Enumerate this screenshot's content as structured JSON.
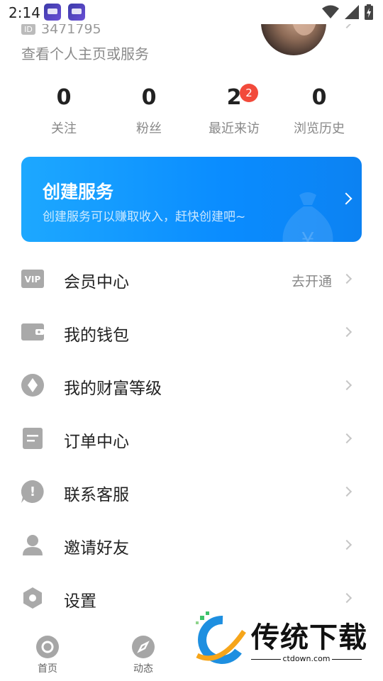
{
  "status_bar": {
    "time": "2:14"
  },
  "profile": {
    "id_tag": "ID",
    "id_number": "3471795",
    "link_text": "查看个人主页或服务"
  },
  "stats": [
    {
      "value": "0",
      "label": "关注"
    },
    {
      "value": "0",
      "label": "粉丝"
    },
    {
      "value": "2",
      "label": "最近来访",
      "badge": "2"
    },
    {
      "value": "0",
      "label": "浏览历史"
    }
  ],
  "banner": {
    "title": "创建服务",
    "subtitle": "创建服务可以赚取收入，赶快创建吧~",
    "bag_glyph": "¥"
  },
  "menu": [
    {
      "label": "会员中心",
      "icon": "vip-icon",
      "icon_text": "VIP",
      "extra": "去开通"
    },
    {
      "label": "我的钱包",
      "icon": "wallet-icon"
    },
    {
      "label": "我的财富等级",
      "icon": "diamond-icon"
    },
    {
      "label": "订单中心",
      "icon": "order-icon"
    },
    {
      "label": "联系客服",
      "icon": "customer-service-icon",
      "icon_text": "!"
    },
    {
      "label": "邀请好友",
      "icon": "invite-friend-icon"
    },
    {
      "label": "设置",
      "icon": "settings-icon"
    }
  ],
  "bottom_nav": [
    {
      "label": "首页",
      "icon": "home-icon"
    },
    {
      "label": "动态",
      "icon": "compass-icon"
    }
  ],
  "watermark": {
    "text": "传统下载",
    "url": "ctdown.com"
  },
  "colors": {
    "accent": "#0a8cff",
    "badge": "#f24a3b",
    "icon_gray": "#a9a9a9"
  }
}
